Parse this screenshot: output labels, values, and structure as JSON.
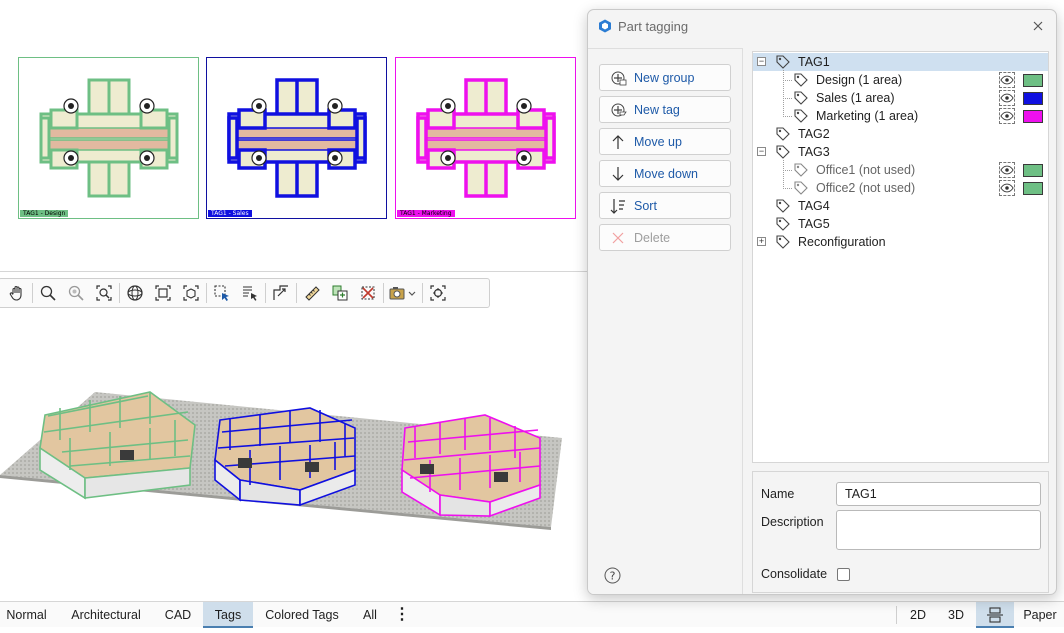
{
  "plans": [
    {
      "label": "TAG1 - Design",
      "color": "#6ebf84"
    },
    {
      "label": "TAG1 - Sales",
      "color": "#1010e0"
    },
    {
      "label": "TAG1 - Marketing",
      "color": "#ee10ee"
    }
  ],
  "toolbar": {
    "tools": [
      "hand-pan-icon",
      "zoom-icon",
      "zoom-in-icon",
      "zoom-extents-icon",
      "orbit-icon",
      "zoom-window-icon",
      "zoom-selection-icon",
      "select-window-icon",
      "select-list-icon",
      "section-icon",
      "measure-icon",
      "copy-paste-icon",
      "delete-icon",
      "camera-icon",
      "locate-icon"
    ]
  },
  "dialog": {
    "title": "Part tagging",
    "buttons": {
      "new_group": "New group",
      "new_tag": "New tag",
      "move_up": "Move up",
      "move_down": "Move down",
      "sort": "Sort",
      "delete": "Delete"
    },
    "tree": [
      {
        "label": "TAG1",
        "level": 0,
        "expander": "−",
        "selected": true
      },
      {
        "label": "Design (1 area)",
        "level": 1,
        "color": "#6ebf84"
      },
      {
        "label": "Sales (1 area)",
        "level": 1,
        "color": "#1010e0"
      },
      {
        "label": "Marketing (1 area)",
        "level": 1,
        "color": "#ee10ee"
      },
      {
        "label": "TAG2",
        "level": 0
      },
      {
        "label": "TAG3",
        "level": 0,
        "expander": "−"
      },
      {
        "label": "Office1 (not used)",
        "level": 1,
        "color": "#6ebf84"
      },
      {
        "label": "Office2 (not used)",
        "level": 1,
        "color": "#6ebf84"
      },
      {
        "label": "TAG4",
        "level": 0
      },
      {
        "label": "TAG5",
        "level": 0
      },
      {
        "label": "Reconfiguration",
        "level": 0,
        "expander": "+"
      }
    ],
    "properties": {
      "name_label": "Name",
      "name_value": "TAG1",
      "description_label": "Description",
      "description_value": "",
      "consolidate_label": "Consolidate",
      "consolidate_checked": false
    }
  },
  "tabs": {
    "items": [
      "Normal",
      "Architectural",
      "CAD",
      "Tags",
      "Colored Tags",
      "All"
    ],
    "active": "Tags",
    "more": "⋮",
    "view_2d": "2D",
    "view_3d": "3D",
    "paper": "Paper"
  }
}
